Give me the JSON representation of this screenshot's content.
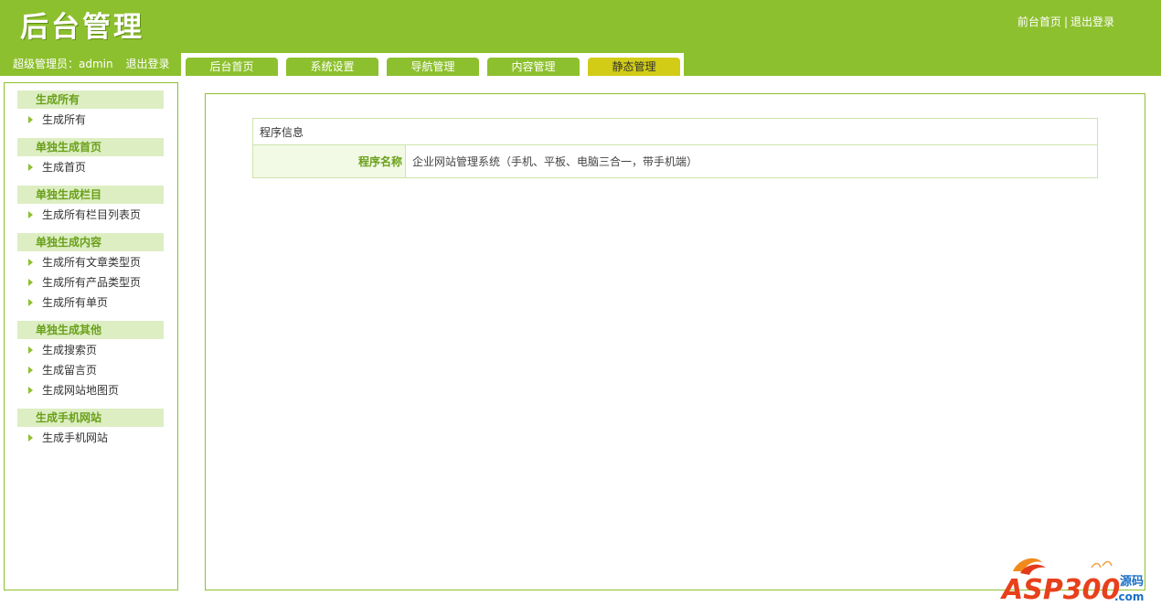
{
  "header": {
    "title": "后台管理",
    "links": {
      "front_home": "前台首页",
      "separator": "|",
      "logout": "退出登录"
    },
    "user": {
      "label": "超级管理员：admin",
      "logout": "退出登录"
    }
  },
  "tabs": [
    {
      "label": "后台首页",
      "active": false
    },
    {
      "label": "系统设置",
      "active": false
    },
    {
      "label": "导航管理",
      "active": false
    },
    {
      "label": "内容管理",
      "active": false
    },
    {
      "label": "静态管理",
      "active": true
    }
  ],
  "sidebar": {
    "groups": [
      {
        "title": "生成所有",
        "items": [
          "生成所有"
        ]
      },
      {
        "title": "单独生成首页",
        "items": [
          "生成首页"
        ]
      },
      {
        "title": "单独生成栏目",
        "items": [
          "生成所有栏目列表页"
        ]
      },
      {
        "title": "单独生成内容",
        "items": [
          "生成所有文章类型页",
          "生成所有产品类型页",
          "生成所有单页"
        ]
      },
      {
        "title": "单独生成其他",
        "items": [
          "生成搜索页",
          "生成留言页",
          "生成网站地图页"
        ]
      },
      {
        "title": "生成手机网站",
        "items": [
          "生成手机网站"
        ]
      }
    ]
  },
  "main": {
    "info_table": {
      "heading": "程序信息",
      "rows": [
        {
          "label": "程序名称",
          "value": "企业网站管理系统（手机、平板、电脑三合一，带手机端）"
        }
      ]
    }
  },
  "watermark": {
    "brand": "ASP300",
    "suffix": ".com",
    "tag": "源码"
  },
  "colors": {
    "header_green": "#8dc02e",
    "active_tab": "#d2cc17",
    "group_title_bg": "#ddeec3",
    "accent_text": "#6aa01a"
  }
}
